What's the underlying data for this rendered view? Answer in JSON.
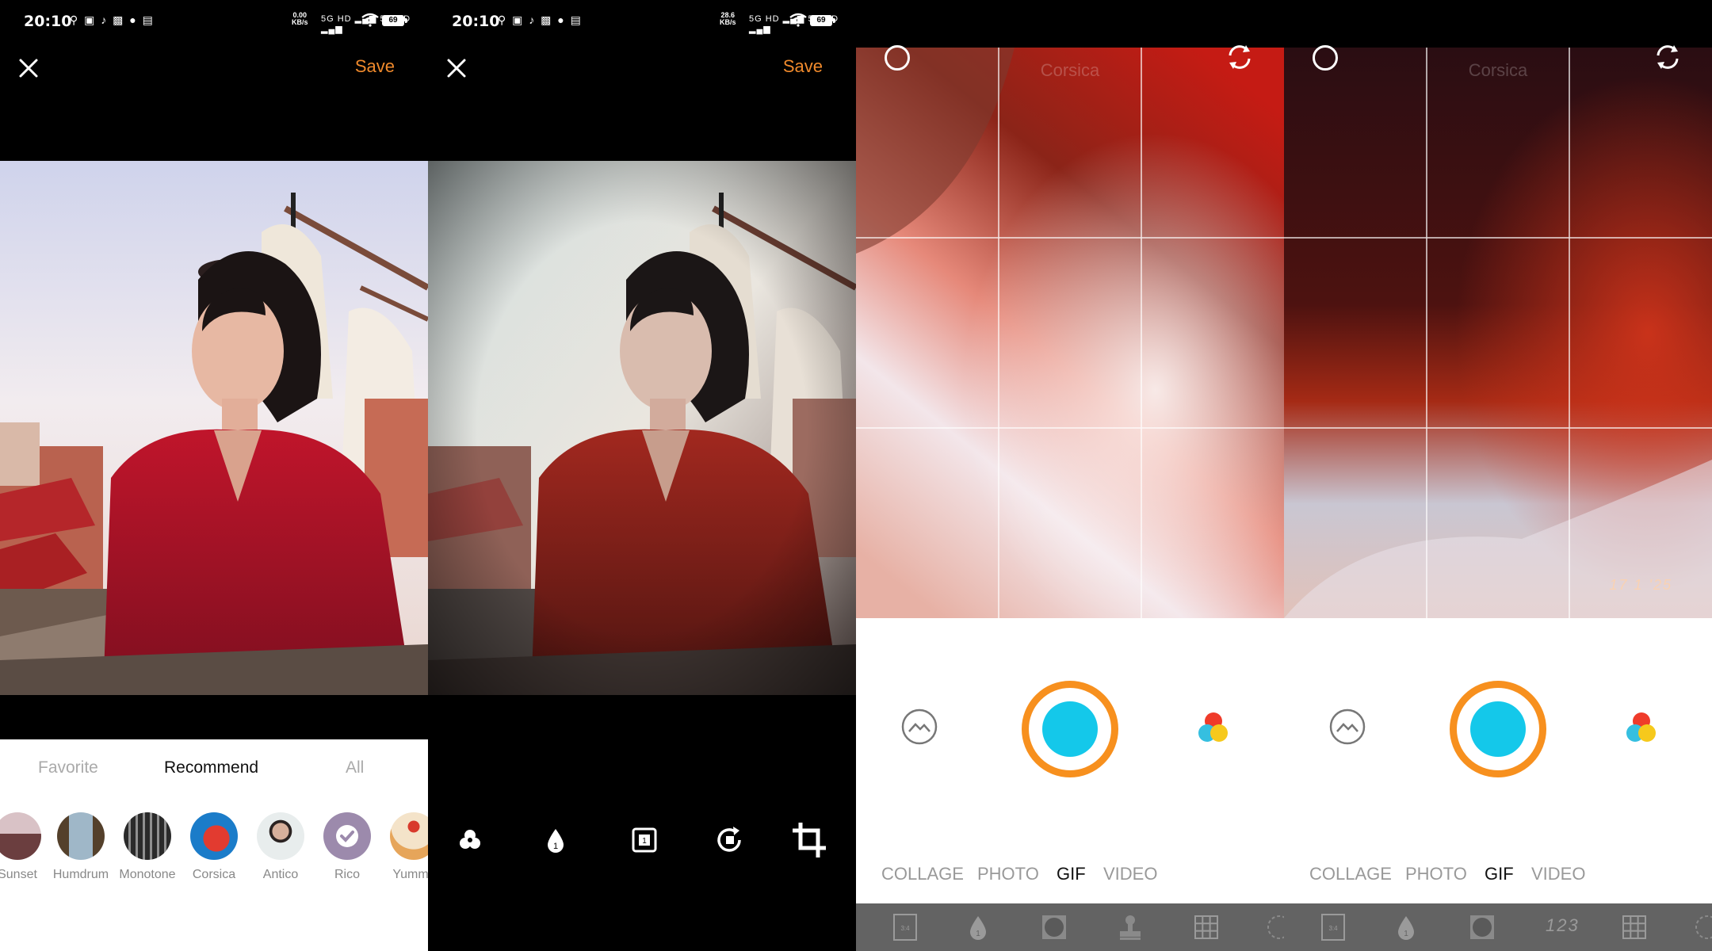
{
  "screens": [
    {
      "status": {
        "time": "20:10",
        "icons": "⚲ ▣ ♪ ▩ ● ▤",
        "net_rate": "0.00",
        "net_unit": "KB/s",
        "signal": "5G HD ▂▄▆ 5G HD ▂▄▆",
        "battery": "69"
      },
      "header": {
        "save_label": "Save"
      },
      "filter_tabs": [
        {
          "label": "Favorite"
        },
        {
          "label": "Recommend"
        },
        {
          "label": "All"
        }
      ],
      "filters": [
        {
          "label": "Sunset"
        },
        {
          "label": "Humdrum"
        },
        {
          "label": "Monotone"
        },
        {
          "label": "Corsica"
        },
        {
          "label": "Antico"
        },
        {
          "label": "Rico"
        },
        {
          "label": "Yummy"
        }
      ]
    },
    {
      "status": {
        "time": "20:10",
        "icons": "⚲ ▣ ♪ ▩ ● ▤",
        "net_rate": "28.6",
        "net_unit": "KB/s",
        "signal": "5G HD ▂▄▆ 5G HD ▂▄▆",
        "battery": "69"
      },
      "header": {
        "save_label": "Save"
      },
      "tools": [
        {
          "icon": "filter-icon"
        },
        {
          "icon": "drop-icon"
        },
        {
          "icon": "frame-icon"
        },
        {
          "icon": "rotate-icon"
        },
        {
          "icon": "crop-icon"
        }
      ]
    },
    {
      "viewfinder": {
        "filter_name": "Corsica"
      },
      "modes": [
        {
          "label": "COLLAGE"
        },
        {
          "label": "PHOTO"
        },
        {
          "label": "GIF"
        },
        {
          "label": "VIDEO"
        }
      ],
      "bottom_tools": [
        {
          "icon": "aspect-ratio-icon",
          "text": "3:4"
        },
        {
          "icon": "drop-icon"
        },
        {
          "icon": "vignette-icon"
        },
        {
          "icon": "stamp-icon"
        },
        {
          "icon": "grid-icon"
        },
        {
          "icon": "timer-icon"
        }
      ]
    },
    {
      "viewfinder": {
        "filter_name": "Corsica",
        "date_stamp": "17 1 '25"
      },
      "modes": [
        {
          "label": "COLLAGE"
        },
        {
          "label": "PHOTO"
        },
        {
          "label": "GIF"
        },
        {
          "label": "VIDEO"
        }
      ],
      "bottom_tools": [
        {
          "icon": "aspect-ratio-icon",
          "text": "3:4"
        },
        {
          "icon": "drop-icon"
        },
        {
          "icon": "vignette-icon"
        },
        {
          "icon": "date-stamp-icon",
          "text": "123"
        },
        {
          "icon": "grid-icon"
        },
        {
          "icon": "timer-icon"
        }
      ]
    }
  ],
  "colors": {
    "accent": "#f08a2c",
    "shutter_ring": "#f7901e",
    "shutter_core": "#14c8ea",
    "toolbar_gray": "#636363"
  }
}
